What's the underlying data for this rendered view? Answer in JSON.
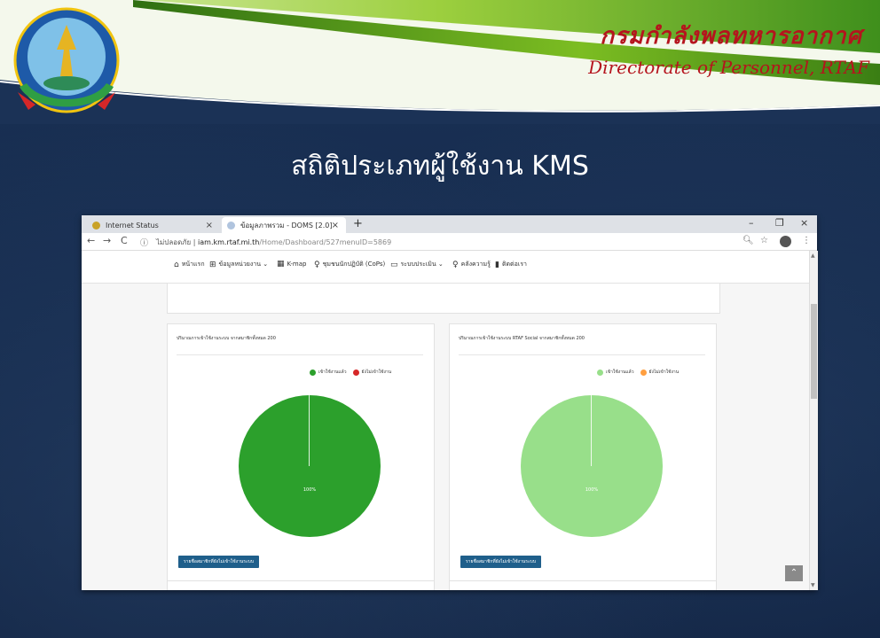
{
  "slide": {
    "org_thai": "กรมกำลังพลทหารอากาศ",
    "org_english": "Directorate of Personnel, RTAF",
    "title": "สถิติประเภทผู้ใช้งาน KMS"
  },
  "browser": {
    "tabs": [
      {
        "label": "Internet Status",
        "close": "×"
      },
      {
        "label": "ข้อมูลภาพรวม - DOMS [2.0]",
        "close": "×"
      }
    ],
    "new_tab": "+",
    "window_controls": {
      "minimize": "–",
      "maximize": "❐",
      "close": "×"
    },
    "address": {
      "security_label": "ไม่ปลอดภัย",
      "host": "iam.km.rtaf.mi.th",
      "path": "/Home/Dashboard/527menuID=5869"
    }
  },
  "site_nav": {
    "items": [
      {
        "icon": "home-icon",
        "label": "หน้าแรก"
      },
      {
        "icon": "grid-icon",
        "label": "ข้อมูลหน่วยงาน ⌄"
      },
      {
        "icon": "map-icon",
        "label": "K-map"
      },
      {
        "icon": "bulb-icon",
        "label": "ชุมชนนักปฏิบัติ (CoPs)"
      },
      {
        "icon": "folder-icon",
        "label": "ระบบประเมิน ⌄"
      },
      {
        "icon": "bulb-icon",
        "label": "คลังความรู้"
      },
      {
        "icon": "book-icon",
        "label": "ติดต่อเรา"
      }
    ]
  },
  "cards": [
    {
      "title": "ปริมาณการเข้าใช้งานระบบ จากสมาชิกทั้งหมด 200",
      "legend": [
        {
          "label": "เข้าใช้งานแล้ว",
          "color": "#2ca02c"
        },
        {
          "label": "ยังไม่เข้าใช้งาน",
          "color": "#d62728"
        }
      ],
      "pie_label": "100%",
      "pie_color": "#2ca02c",
      "button": "รายชื่อสมาชิกที่ยังไม่เข้าใช้งานระบบ"
    },
    {
      "title": "ปริมาณการเข้าใช้งานระบบ RTAF Social จากสมาชิกทั้งหมด 200",
      "legend": [
        {
          "label": "เข้าใช้งานแล้ว",
          "color": "#98df8a"
        },
        {
          "label": "ยังไม่เข้าใช้งาน",
          "color": "#ff9f40"
        }
      ],
      "pie_label": "100%",
      "pie_color": "#98df8a",
      "button": "รายชื่อสมาชิกที่ยังไม่เข้าใช้งานระบบ"
    }
  ],
  "chart_data": [
    {
      "type": "pie",
      "categories": [
        "เข้าใช้งานแล้ว",
        "ยังไม่เข้าใช้งาน"
      ],
      "values": [
        100,
        0
      ],
      "title": "ปริมาณการเข้าใช้งานระบบ จากสมาชิกทั้งหมด 200"
    },
    {
      "type": "pie",
      "categories": [
        "เข้าใช้งานแล้ว",
        "ยังไม่เข้าใช้งาน"
      ],
      "values": [
        100,
        0
      ],
      "title": "ปริมาณการเข้าใช้งานระบบ RTAF Social จากสมาชิกทั้งหมด 200"
    }
  ],
  "back_to_top": "⌃"
}
